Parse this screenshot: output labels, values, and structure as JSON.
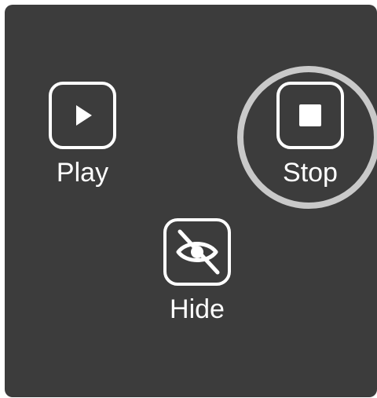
{
  "panel": {
    "background": "#3c3c3c"
  },
  "controls": {
    "play": {
      "label": "Play",
      "icon": "play-icon"
    },
    "stop": {
      "label": "Stop",
      "icon": "stop-icon",
      "focused": true
    },
    "hide": {
      "label": "Hide",
      "icon": "eye-slash-icon"
    }
  },
  "colors": {
    "foreground": "#ffffff",
    "focus_ring": "#c9c9c9"
  }
}
